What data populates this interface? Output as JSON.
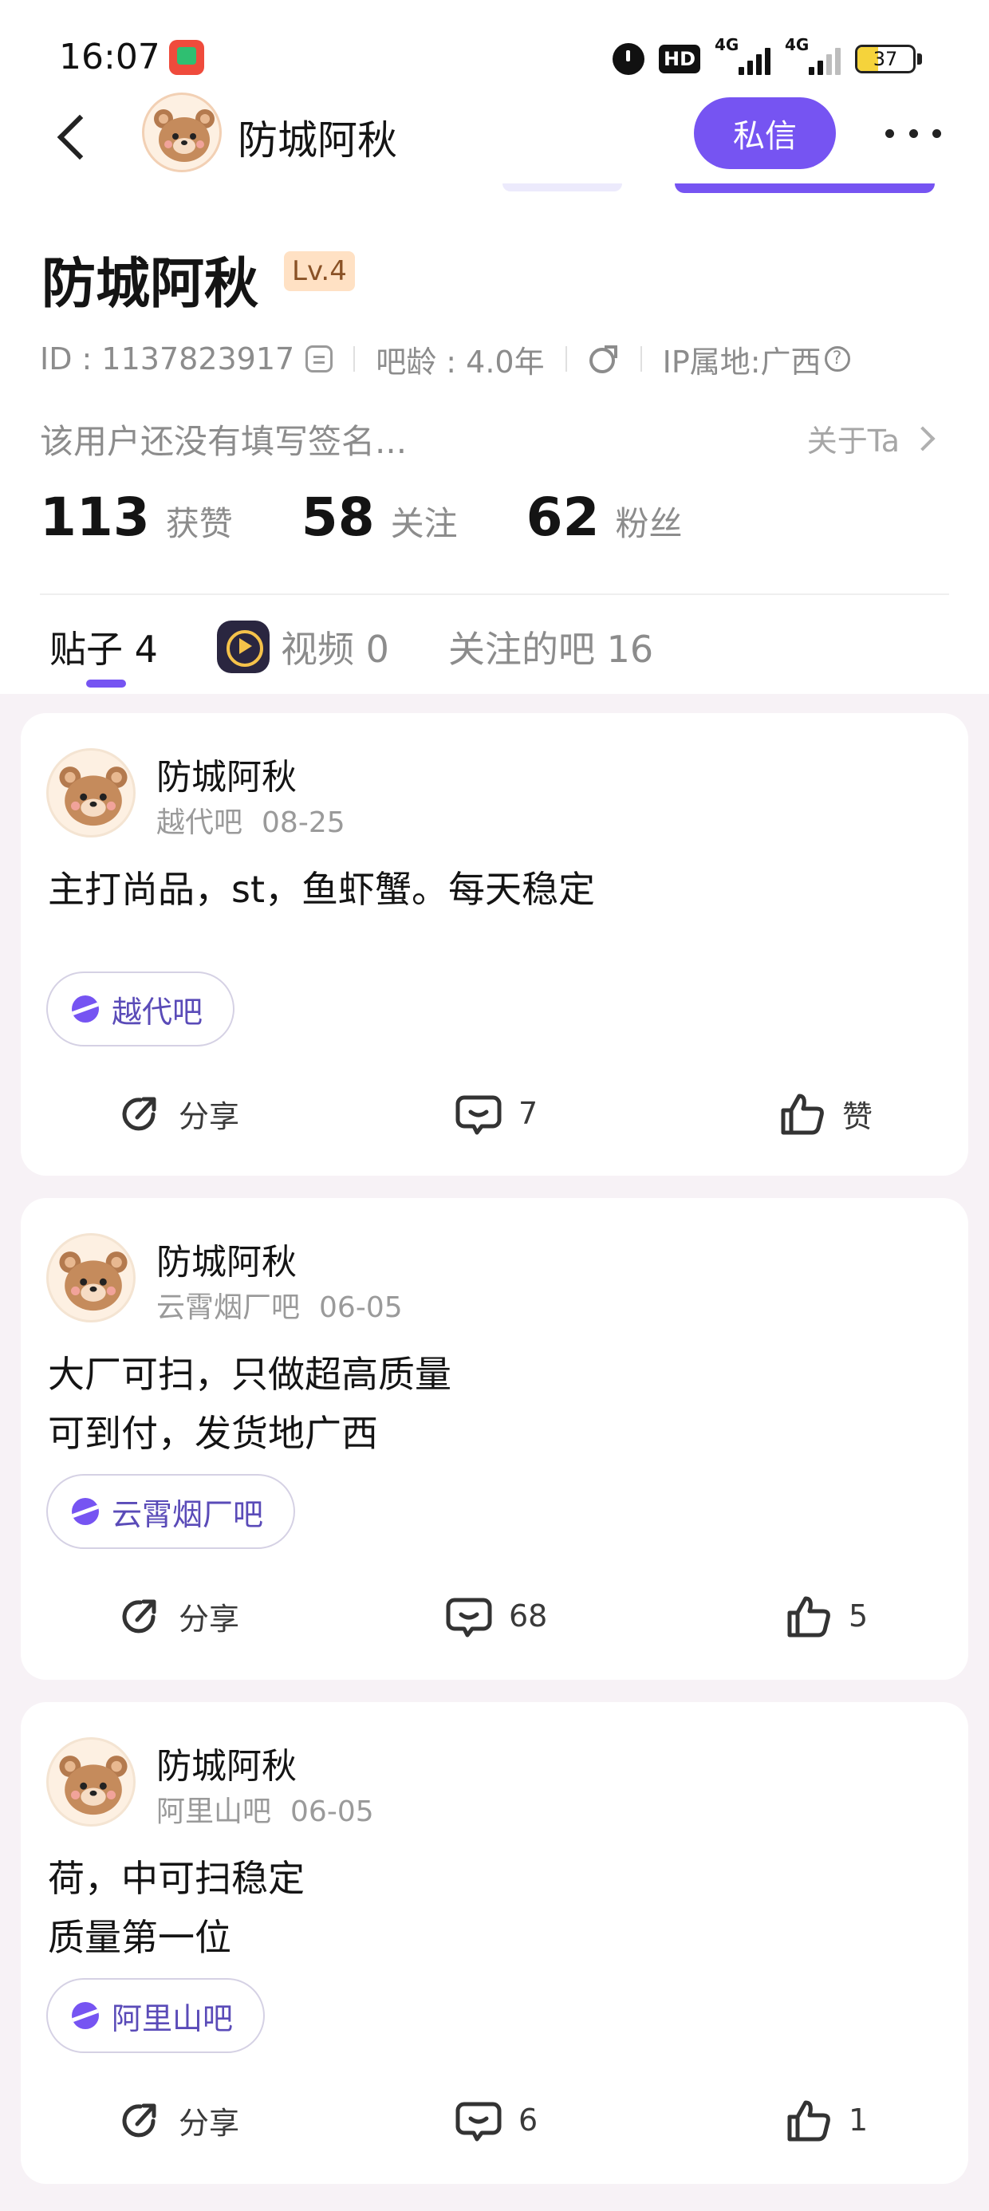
{
  "status_bar": {
    "time": "16:07",
    "hd": "HD",
    "net1": "4G",
    "net2": "4G",
    "battery": "37",
    "battery_level": 0.37
  },
  "header": {
    "name": "防城阿秋",
    "dm_label": "私信"
  },
  "profile": {
    "name": "防城阿秋",
    "level": "Lv.4",
    "id_text": "ID : 1137823917",
    "bar_age": "吧龄 : 4.0年",
    "ip": "IP属地:广西",
    "signature": "该用户还没有填写签名...",
    "about": "关于Ta",
    "stats": [
      {
        "num": "113",
        "label": "获赞"
      },
      {
        "num": "58",
        "label": "关注"
      },
      {
        "num": "62",
        "label": "粉丝"
      }
    ]
  },
  "tabs": [
    {
      "label": "贴子 4"
    },
    {
      "label": "视频 0"
    },
    {
      "label": "关注的吧 16"
    }
  ],
  "posts": [
    {
      "author": "防城阿秋",
      "forum": "越代吧",
      "date": "08-25",
      "lines": [
        "主打尚品，st，鱼虾蟹。每天稳定"
      ],
      "tag": "越代吧",
      "share": "分享",
      "comments": "7",
      "likes": "赞"
    },
    {
      "author": "防城阿秋",
      "forum": "云霄烟厂吧",
      "date": "06-05",
      "lines": [
        "大厂可扫，只做超高质量",
        "可到付，发货地广西"
      ],
      "tag": "云霄烟厂吧",
      "share": "分享",
      "comments": "68",
      "likes": "5"
    },
    {
      "author": "防城阿秋",
      "forum": "阿里山吧",
      "date": "06-05",
      "lines": [
        "荷，中可扫稳定",
        "质量第一位"
      ],
      "tag": "阿里山吧",
      "share": "分享",
      "comments": "6",
      "likes": "1"
    }
  ],
  "colors": {
    "accent": "#7654f2",
    "feed_bg": "#f7f2f6"
  }
}
